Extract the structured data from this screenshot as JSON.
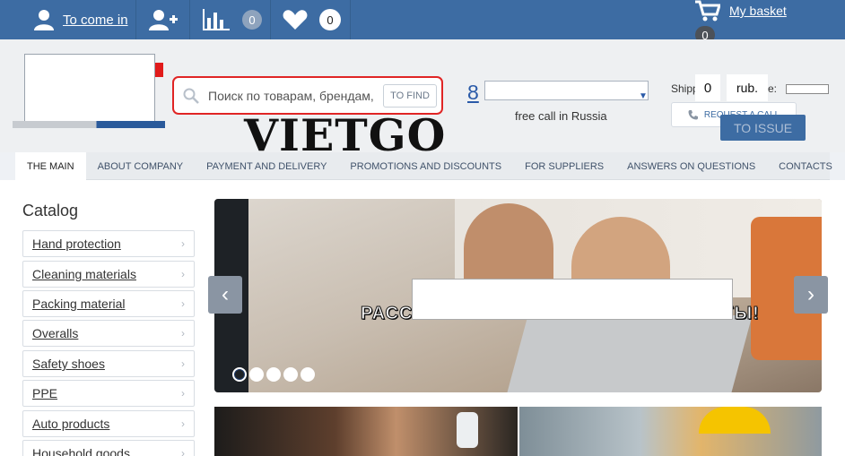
{
  "topbar": {
    "login_label": "To come in",
    "compare_count": "0",
    "favorites_count": "0",
    "basket_label": "My basket",
    "basket_count": "0"
  },
  "search": {
    "placeholder": "Поиск по товарам, брендам,",
    "button_label": "TO FIND"
  },
  "brand": "VIETGO",
  "contact": {
    "phone_prefix": "8",
    "free_call": "free call in Russia"
  },
  "shipping": {
    "label_part1": "Shipp",
    "label_part2": "se:",
    "cart_count": "0",
    "currency": "rub.",
    "request_label": "REQUEST A CALL",
    "issue_label": "TO ISSUE"
  },
  "nav": {
    "items": [
      "THE MAIN",
      "ABOUT COMPANY",
      "PAYMENT AND DELIVERY",
      "PROMOTIONS AND DISCOUNTS",
      "FOR SUPPLIERS",
      "ANSWERS ON QUESTIONS",
      "CONTACTS"
    ]
  },
  "catalog": {
    "title": "Catalog",
    "items": [
      "Hand protection",
      "Cleaning materials",
      "Packing material",
      "Overalls",
      "Safety shoes",
      "PPE",
      "Auto products",
      "Household goods"
    ]
  },
  "slider": {
    "caption": "РАССЫЛКА ПРАЙСОВ НА ВСЕ КЛИЕНТЫ!",
    "prev_symbol": "‹",
    "next_symbol": "›",
    "dot_count": 5
  },
  "colors": {
    "topbar": "#3d6ca3",
    "accent_red": "#e02525",
    "link_blue": "#2a5aa8"
  }
}
